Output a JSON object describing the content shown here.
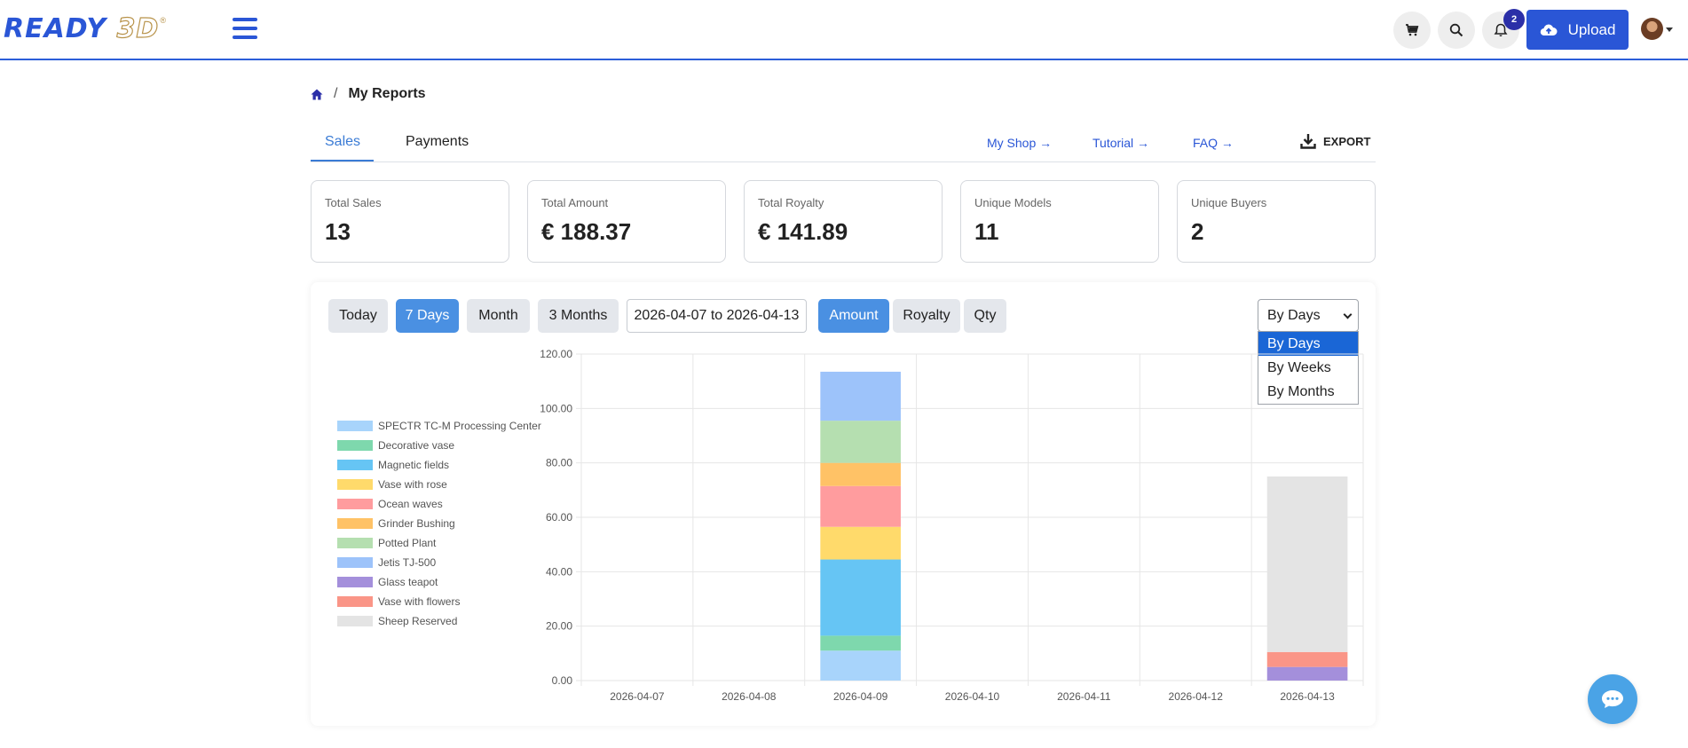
{
  "navbar": {
    "logo_main": "READY ",
    "logo_accent": "3D",
    "logo_reg": "®",
    "notification_count": "2",
    "upload_label": "Upload",
    "icons": [
      "cart-icon",
      "search-icon",
      "bell-icon",
      "cloud-upload-icon",
      "avatar",
      "menu-icon"
    ]
  },
  "breadcrumb": {
    "separator": "/",
    "current": "My Reports"
  },
  "tabs": {
    "sales": "Sales",
    "payments": "Payments"
  },
  "links": {
    "shop": "My Shop →",
    "tutorial": "Tutorial →",
    "faq": "FAQ →",
    "export": "EXPORT"
  },
  "stats": [
    {
      "label": "Total Sales",
      "value": "13"
    },
    {
      "label": "Total Amount",
      "value": "€ 188.37"
    },
    {
      "label": "Total Royalty",
      "value": "€ 141.89"
    },
    {
      "label": "Unique Models",
      "value": "11"
    },
    {
      "label": "Unique Buyers",
      "value": "2"
    }
  ],
  "filters": {
    "ranges": [
      "Today",
      "7 Days",
      "Month",
      "3 Months"
    ],
    "active_range": "7 Days",
    "date_range": "2026-04-07 to 2026-04-13",
    "metrics": [
      "Amount",
      "Royalty",
      "Qty"
    ],
    "active_metric": "Amount",
    "grouping": "By Days",
    "grouping_options": [
      "By Days",
      "By Weeks",
      "By Months"
    ]
  },
  "colors": {
    "brand": "#2a56d6",
    "accent": "#4a90e2",
    "badge": "#2b2fa8"
  },
  "chart_data": {
    "type": "bar",
    "stacked": true,
    "categories": [
      "2026-04-07",
      "2026-04-08",
      "2026-04-09",
      "2026-04-10",
      "2026-04-11",
      "2026-04-12",
      "2026-04-13"
    ],
    "ylim": [
      0,
      120
    ],
    "yticks": [
      "0.00",
      "20.00",
      "40.00",
      "60.00",
      "80.00",
      "100.00",
      "120.00"
    ],
    "grid": true,
    "legend_position": "left",
    "series": [
      {
        "name": "SPECTR TC-M Processing Center",
        "color": "#a8d4fb",
        "values": [
          0,
          0,
          11,
          0,
          0,
          0,
          0
        ]
      },
      {
        "name": "Decorative vase",
        "color": "#7ed8ad",
        "values": [
          0,
          0,
          5.5,
          0,
          0,
          0,
          0
        ]
      },
      {
        "name": "Magnetic fields",
        "color": "#66c5f4",
        "values": [
          0,
          0,
          28,
          0,
          0,
          0,
          0
        ]
      },
      {
        "name": "Vase with rose",
        "color": "#ffda6b",
        "values": [
          0,
          0,
          12,
          0,
          0,
          0,
          0
        ]
      },
      {
        "name": "Ocean waves",
        "color": "#ff9c9e",
        "values": [
          0,
          0,
          15,
          0,
          0,
          0,
          0
        ]
      },
      {
        "name": "Grinder Bushing",
        "color": "#ffc266",
        "values": [
          0,
          0,
          8.5,
          0,
          0,
          0,
          0
        ]
      },
      {
        "name": "Potted Plant",
        "color": "#b5dfb0",
        "values": [
          0,
          0,
          15.5,
          0,
          0,
          0,
          0
        ]
      },
      {
        "name": "Jetis TJ-500",
        "color": "#9dc3fa",
        "values": [
          0,
          0,
          18,
          0,
          0,
          0,
          0
        ]
      },
      {
        "name": "Glass teapot",
        "color": "#a48fdb",
        "values": [
          0,
          0,
          0,
          0,
          0,
          0,
          5
        ]
      },
      {
        "name": "Vase with flowers",
        "color": "#fa9587",
        "values": [
          0,
          0,
          0,
          0,
          0,
          0,
          5.5
        ]
      },
      {
        "name": "Sheep Reserved",
        "color": "#e4e4e4",
        "values": [
          0,
          0,
          0,
          0,
          0,
          0,
          64.5
        ]
      }
    ]
  }
}
